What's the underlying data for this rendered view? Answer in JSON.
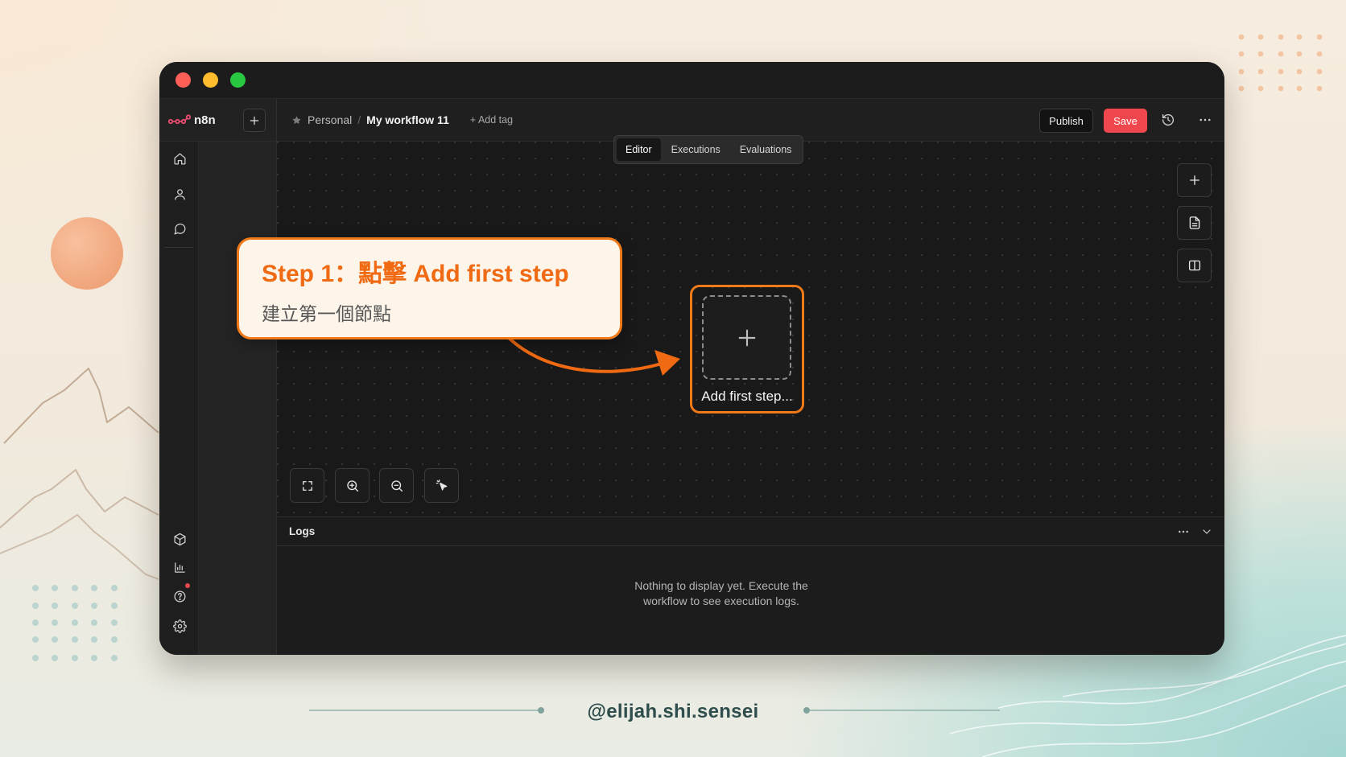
{
  "window": {
    "traffic_light_colors": [
      "#ff5f57",
      "#febc2e",
      "#28c840"
    ]
  },
  "brand": {
    "name": "n8n",
    "logo_icon": "n8n-logo-icon",
    "create_icon": "plus-icon"
  },
  "sidebar": {
    "top_icons": [
      "home-icon",
      "user-icon",
      "chat-icon"
    ],
    "bottom_icons": [
      "cube-icon",
      "bar-chart-icon",
      "help-icon",
      "gear-icon"
    ]
  },
  "header": {
    "favorite_icon": "star-icon",
    "breadcrumb": {
      "project": "Personal",
      "separator": "/",
      "workflow": "My workflow 11"
    },
    "add_tag": "+ Add tag",
    "publish_label": "Publish",
    "save_label": "Save",
    "history_icon": "history-icon",
    "more_icon": "more-horizontal-icon"
  },
  "tabs": [
    {
      "label": "Editor",
      "active": true
    },
    {
      "label": "Executions",
      "active": false
    },
    {
      "label": "Evaluations",
      "active": false
    }
  ],
  "canvas": {
    "add_first_step_label": "Add first step...",
    "add_first_step_icon": "plus-icon",
    "side_tools": [
      "plus-icon",
      "file-text-icon",
      "split-panel-icon"
    ],
    "view_controls": [
      "fit-view-icon",
      "zoom-in-icon",
      "zoom-out-icon",
      "pointer-icon"
    ]
  },
  "logs": {
    "title": "Logs",
    "empty_message": [
      "Nothing to display yet. Execute the",
      "workflow to see execution logs."
    ],
    "more_icon": "more-horizontal-icon",
    "collapse_icon": "chevron-down-icon"
  },
  "callout": {
    "title": "Step 1：點擊 Add first step",
    "subtitle": "建立第一個節點"
  },
  "footer": {
    "handle": "@elijah.shi.sensei"
  },
  "colors": {
    "accent_orange": "#f07a1a",
    "annotation_text": "#ef6a12",
    "save_red": "#f0474e",
    "brand_pink": "#ea4b71",
    "footer_text": "#2e4d4c"
  }
}
